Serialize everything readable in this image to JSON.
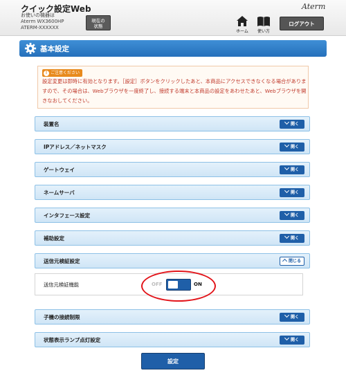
{
  "header": {
    "app_title": "クイック設定Web",
    "device_caption": "お使いの機器は",
    "device_model": "Aterm WX3600HP",
    "device_id": "ATERM-XXXXXX",
    "status_button_line1": "現在の",
    "status_button_line2": "状態",
    "brand": "Aterm",
    "nav_home": "ホーム",
    "nav_help": "使い方",
    "logout_label": "ログアウト"
  },
  "section": {
    "title": "基本設定"
  },
  "notice": {
    "badge": "ご注意ください",
    "text": "設定変更は即時に有効となります。［設定］ボタンをクリックしたあと、本商品にアクセスできなくなる場合がありますので、その場合は、Webブラウザを一度終了し、接続する端末と本商品の設定をあわせたあと、Webブラウザを開きなおしてください。"
  },
  "accordion": {
    "open_label": "開く",
    "close_label": "閉じる",
    "items": [
      {
        "label": "装置名"
      },
      {
        "label": "IPアドレス／ネットマスク"
      },
      {
        "label": "ゲートウェイ"
      },
      {
        "label": "ネームサーバ"
      },
      {
        "label": "インタフェース設定"
      },
      {
        "label": "補助設定"
      },
      {
        "label": "送信元検証設定"
      },
      {
        "label": "子機の接続制限"
      },
      {
        "label": "状態表示ランプ点灯設定"
      }
    ]
  },
  "source_verification": {
    "field_label": "送信元検証機能",
    "off_label": "OFF",
    "on_label": "ON",
    "state": "ON"
  },
  "submit_label": "設定",
  "colors": {
    "accent_blue": "#1f5fa8",
    "section_blue": "#2d7cc8",
    "notice_red": "#c0392b",
    "badge_orange": "#e88a1d",
    "highlight_red": "#e2141a"
  }
}
